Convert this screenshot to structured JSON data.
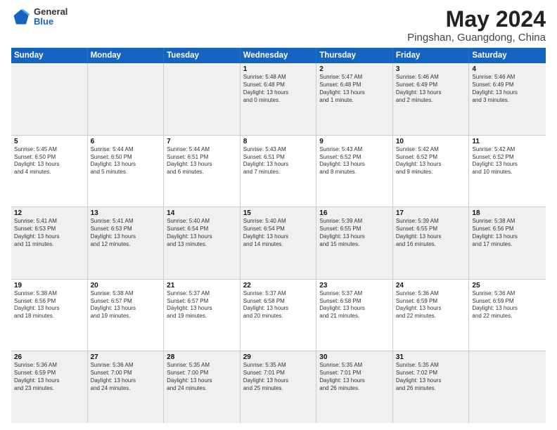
{
  "header": {
    "logo": {
      "general": "General",
      "blue": "Blue"
    },
    "title": "May 2024",
    "subtitle": "Pingshan, Guangdong, China"
  },
  "weekdays": [
    "Sunday",
    "Monday",
    "Tuesday",
    "Wednesday",
    "Thursday",
    "Friday",
    "Saturday"
  ],
  "rows": [
    [
      {
        "day": "",
        "info": ""
      },
      {
        "day": "",
        "info": ""
      },
      {
        "day": "",
        "info": ""
      },
      {
        "day": "1",
        "info": "Sunrise: 5:48 AM\nSunset: 6:48 PM\nDaylight: 13 hours\nand 0 minutes."
      },
      {
        "day": "2",
        "info": "Sunrise: 5:47 AM\nSunset: 6:48 PM\nDaylight: 13 hours\nand 1 minute."
      },
      {
        "day": "3",
        "info": "Sunrise: 5:46 AM\nSunset: 6:49 PM\nDaylight: 13 hours\nand 2 minutes."
      },
      {
        "day": "4",
        "info": "Sunrise: 5:46 AM\nSunset: 6:49 PM\nDaylight: 13 hours\nand 3 minutes."
      }
    ],
    [
      {
        "day": "5",
        "info": "Sunrise: 5:45 AM\nSunset: 6:50 PM\nDaylight: 13 hours\nand 4 minutes."
      },
      {
        "day": "6",
        "info": "Sunrise: 5:44 AM\nSunset: 6:50 PM\nDaylight: 13 hours\nand 5 minutes."
      },
      {
        "day": "7",
        "info": "Sunrise: 5:44 AM\nSunset: 6:51 PM\nDaylight: 13 hours\nand 6 minutes."
      },
      {
        "day": "8",
        "info": "Sunrise: 5:43 AM\nSunset: 6:51 PM\nDaylight: 13 hours\nand 7 minutes."
      },
      {
        "day": "9",
        "info": "Sunrise: 5:43 AM\nSunset: 6:52 PM\nDaylight: 13 hours\nand 8 minutes."
      },
      {
        "day": "10",
        "info": "Sunrise: 5:42 AM\nSunset: 6:52 PM\nDaylight: 13 hours\nand 9 minutes."
      },
      {
        "day": "11",
        "info": "Sunrise: 5:42 AM\nSunset: 6:52 PM\nDaylight: 13 hours\nand 10 minutes."
      }
    ],
    [
      {
        "day": "12",
        "info": "Sunrise: 5:41 AM\nSunset: 6:53 PM\nDaylight: 13 hours\nand 11 minutes."
      },
      {
        "day": "13",
        "info": "Sunrise: 5:41 AM\nSunset: 6:53 PM\nDaylight: 13 hours\nand 12 minutes."
      },
      {
        "day": "14",
        "info": "Sunrise: 5:40 AM\nSunset: 6:54 PM\nDaylight: 13 hours\nand 13 minutes."
      },
      {
        "day": "15",
        "info": "Sunrise: 5:40 AM\nSunset: 6:54 PM\nDaylight: 13 hours\nand 14 minutes."
      },
      {
        "day": "16",
        "info": "Sunrise: 5:39 AM\nSunset: 6:55 PM\nDaylight: 13 hours\nand 15 minutes."
      },
      {
        "day": "17",
        "info": "Sunrise: 5:39 AM\nSunset: 6:55 PM\nDaylight: 13 hours\nand 16 minutes."
      },
      {
        "day": "18",
        "info": "Sunrise: 5:38 AM\nSunset: 6:56 PM\nDaylight: 13 hours\nand 17 minutes."
      }
    ],
    [
      {
        "day": "19",
        "info": "Sunrise: 5:38 AM\nSunset: 6:56 PM\nDaylight: 13 hours\nand 18 minutes."
      },
      {
        "day": "20",
        "info": "Sunrise: 5:38 AM\nSunset: 6:57 PM\nDaylight: 13 hours\nand 19 minutes."
      },
      {
        "day": "21",
        "info": "Sunrise: 5:37 AM\nSunset: 6:57 PM\nDaylight: 13 hours\nand 19 minutes."
      },
      {
        "day": "22",
        "info": "Sunrise: 5:37 AM\nSunset: 6:58 PM\nDaylight: 13 hours\nand 20 minutes."
      },
      {
        "day": "23",
        "info": "Sunrise: 5:37 AM\nSunset: 6:58 PM\nDaylight: 13 hours\nand 21 minutes."
      },
      {
        "day": "24",
        "info": "Sunrise: 5:36 AM\nSunset: 6:59 PM\nDaylight: 13 hours\nand 22 minutes."
      },
      {
        "day": "25",
        "info": "Sunrise: 5:36 AM\nSunset: 6:59 PM\nDaylight: 13 hours\nand 22 minutes."
      }
    ],
    [
      {
        "day": "26",
        "info": "Sunrise: 5:36 AM\nSunset: 6:59 PM\nDaylight: 13 hours\nand 23 minutes."
      },
      {
        "day": "27",
        "info": "Sunrise: 5:36 AM\nSunset: 7:00 PM\nDaylight: 13 hours\nand 24 minutes."
      },
      {
        "day": "28",
        "info": "Sunrise: 5:35 AM\nSunset: 7:00 PM\nDaylight: 13 hours\nand 24 minutes."
      },
      {
        "day": "29",
        "info": "Sunrise: 5:35 AM\nSunset: 7:01 PM\nDaylight: 13 hours\nand 25 minutes."
      },
      {
        "day": "30",
        "info": "Sunrise: 5:35 AM\nSunset: 7:01 PM\nDaylight: 13 hours\nand 26 minutes."
      },
      {
        "day": "31",
        "info": "Sunrise: 5:35 AM\nSunset: 7:02 PM\nDaylight: 13 hours\nand 26 minutes."
      },
      {
        "day": "",
        "info": ""
      }
    ]
  ],
  "shaded_rows": [
    0,
    2,
    4
  ],
  "colors": {
    "header_bg": "#1565c0",
    "header_text": "#ffffff",
    "shaded_cell": "#f0f0f0",
    "border": "#cccccc"
  }
}
